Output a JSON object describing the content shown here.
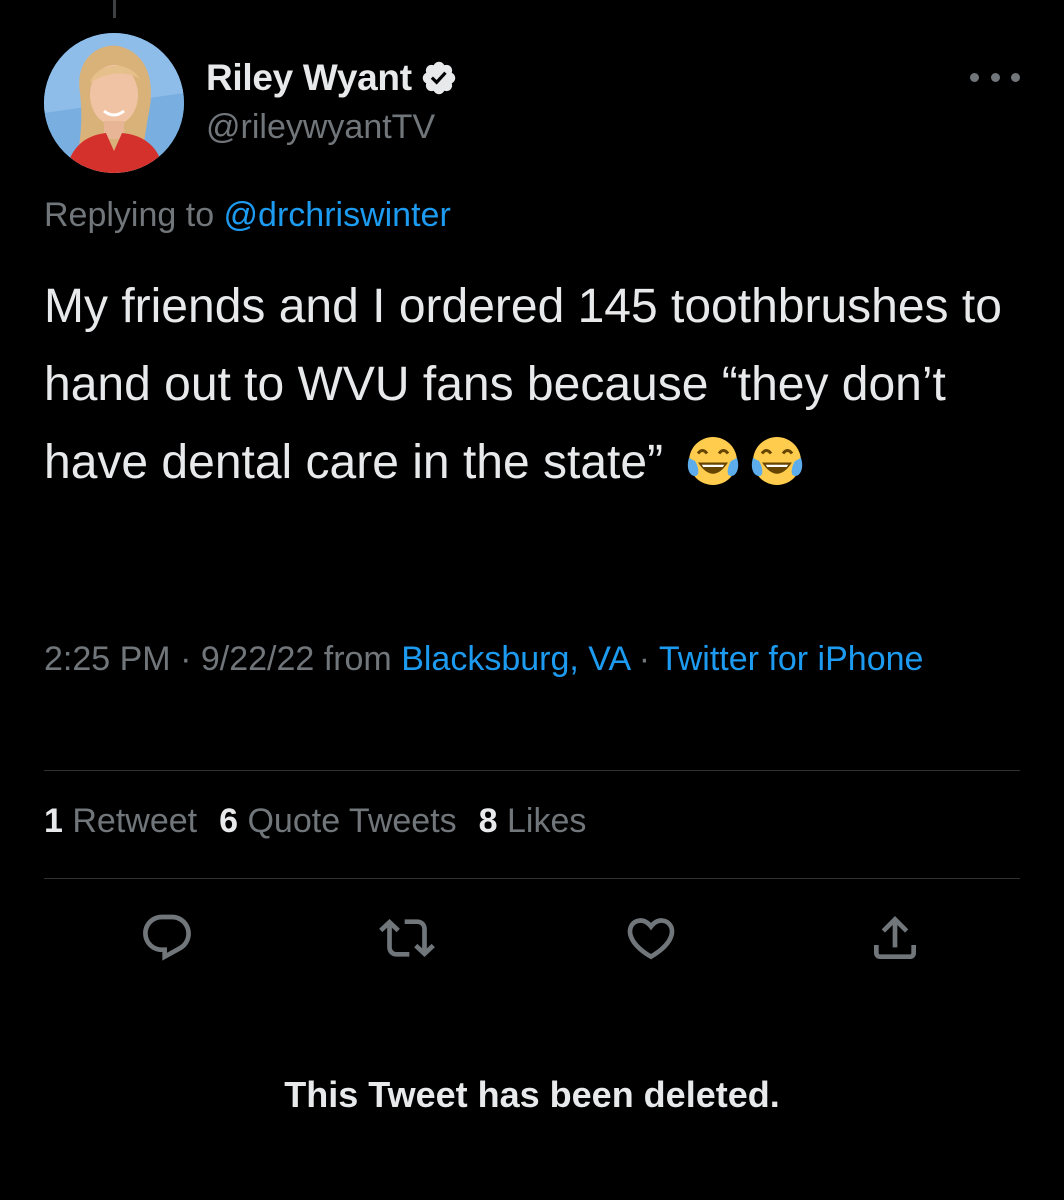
{
  "colors": {
    "background": "#000000",
    "text": "#e7e9ea",
    "secondary": "#71767b",
    "link": "#1d9bf0",
    "divider": "#2f3336"
  },
  "author": {
    "name": "Riley Wyant",
    "handle": "@rileywyantTV",
    "verified_icon": "verified-badge-icon",
    "avatar_icon": "profile-photo"
  },
  "reply": {
    "prefix": "Replying to ",
    "mention": "@drchriswinter"
  },
  "tweet": {
    "text": "My friends and I ordered 145 toothbrushes to hand out to WVU fans because “they don’t have dental care in the state”",
    "emoji": [
      "tears-of-joy-emoji",
      "tears-of-joy-emoji"
    ]
  },
  "meta": {
    "time": "2:25 PM",
    "sep1": " · ",
    "date": "9/22/22",
    "from": " from ",
    "location": "Blacksburg, VA",
    "sep2": " · ",
    "client": "Twitter for iPhone"
  },
  "stats": {
    "retweets": {
      "count": "1",
      "label": " Retweet"
    },
    "quotes": {
      "count": "6",
      "label": " Quote Tweets"
    },
    "likes": {
      "count": "8",
      "label": " Likes"
    }
  },
  "actions": [
    "reply-icon",
    "retweet-icon",
    "like-icon",
    "share-icon"
  ],
  "footer": {
    "deleted_notice": "This Tweet has been deleted."
  }
}
